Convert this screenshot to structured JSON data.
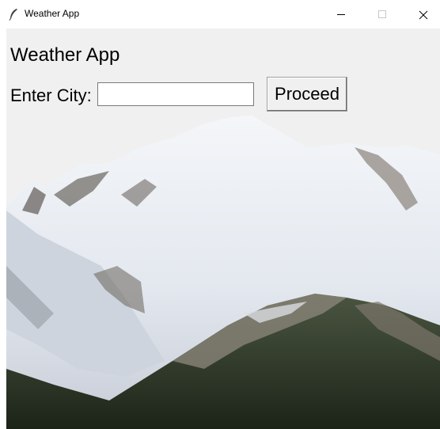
{
  "window": {
    "title": "Weather App",
    "controls": {
      "minimize": "minimize-icon",
      "maximize": "maximize-icon",
      "close": "close-icon"
    },
    "app_icon": "feather-icon"
  },
  "main": {
    "heading": "Weather App",
    "city_label": "Enter City:",
    "city_input_value": "",
    "proceed_label": "Proceed"
  },
  "background_image": "snowy-mountain-photo",
  "colors": {
    "client_bg": "#f0f0f0",
    "titlebar_bg": "#ffffff"
  }
}
